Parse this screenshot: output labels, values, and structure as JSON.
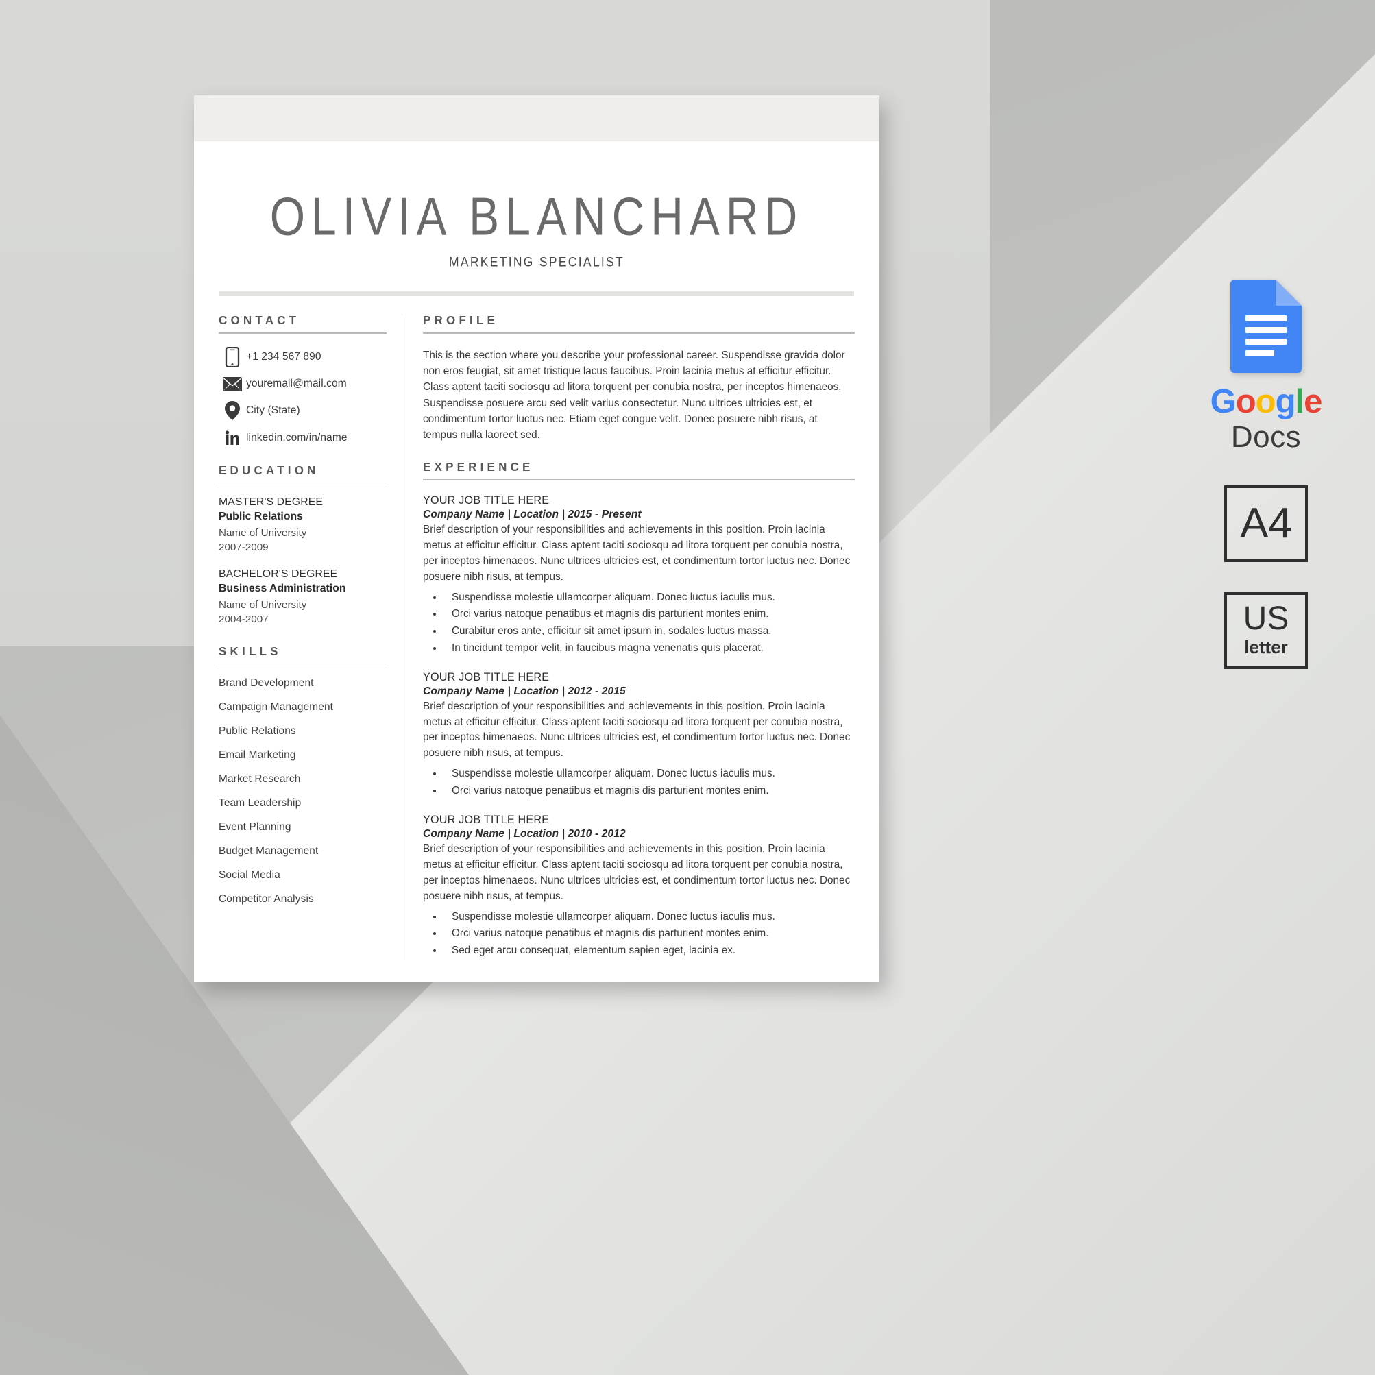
{
  "resume": {
    "name": "OLIVIA BLANCHARD",
    "job_title": "MARKETING SPECIALIST",
    "contact": {
      "heading": "CONTACT",
      "items": [
        {
          "icon": "phone-icon",
          "value": "+1 234 567 890"
        },
        {
          "icon": "envelope-icon",
          "value": "youremail@mail.com"
        },
        {
          "icon": "location-pin-icon",
          "value": "City (State)"
        },
        {
          "icon": "linkedin-icon",
          "value": "linkedin.com/in/name"
        }
      ]
    },
    "education": {
      "heading": "EDUCATION",
      "items": [
        {
          "degree": "MASTER'S DEGREE",
          "field": "Public Relations",
          "school": "Name of University",
          "years": "2007-2009"
        },
        {
          "degree": "BACHELOR'S DEGREE",
          "field": "Business Administration",
          "school": "Name of University",
          "years": "2004-2007"
        }
      ]
    },
    "skills": {
      "heading": "SKILLS",
      "items": [
        "Brand Development",
        "Campaign Management",
        "Public Relations",
        "Email Marketing",
        "Market Research",
        "Team Leadership",
        "Event Planning",
        "Budget Management",
        "Social Media",
        "Competitor Analysis"
      ]
    },
    "profile": {
      "heading": "PROFILE",
      "text": "This is the section where you describe your professional career. Suspendisse gravida dolor non eros feugiat, sit amet tristique lacus faucibus. Proin lacinia metus at efficitur efficitur. Class aptent taciti sociosqu ad litora torquent per conubia nostra, per inceptos himenaeos. Suspendisse posuere arcu sed velit varius consectetur. Nunc ultrices ultricies est, et condimentum tortor luctus nec. Etiam eget congue velit. Donec posuere nibh risus, at tempus nulla laoreet sed."
    },
    "experience": {
      "heading": "EXPERIENCE",
      "jobs": [
        {
          "title": "YOUR JOB TITLE HERE",
          "meta": "Company Name | Location | 2015 - Present",
          "description": "Brief description of your responsibilities and achievements in this position. Proin lacinia metus at efficitur efficitur. Class aptent taciti sociosqu ad litora torquent per conubia nostra, per inceptos himenaeos. Nunc ultrices ultricies est, et condimentum tortor luctus nec. Donec posuere nibh risus, at tempus.",
          "bullets": [
            "Suspendisse molestie ullamcorper aliquam. Donec luctus iaculis mus.",
            "Orci varius natoque penatibus et magnis dis parturient montes enim.",
            "Curabitur eros ante, efficitur sit amet ipsum in, sodales luctus massa.",
            "In tincidunt tempor velit, in faucibus magna venenatis quis placerat."
          ]
        },
        {
          "title": "YOUR JOB TITLE HERE",
          "meta": "Company Name | Location | 2012 - 2015",
          "description": "Brief description of your responsibilities and achievements in this position. Proin lacinia metus at efficitur efficitur. Class aptent taciti sociosqu ad litora torquent per conubia nostra, per inceptos himenaeos. Nunc ultrices ultricies est, et condimentum tortor luctus nec. Donec posuere nibh risus, at tempus.",
          "bullets": [
            "Suspendisse molestie ullamcorper aliquam. Donec luctus iaculis mus.",
            "Orci varius natoque penatibus et magnis dis parturient montes enim."
          ]
        },
        {
          "title": "YOUR JOB TITLE HERE",
          "meta": "Company Name | Location | 2010 - 2012",
          "description": "Brief description of your responsibilities and achievements in this position. Proin lacinia metus at efficitur efficitur. Class aptent taciti sociosqu ad litora torquent per conubia nostra, per inceptos himenaeos. Nunc ultrices ultricies est, et condimentum tortor luctus nec. Donec posuere nibh risus, at tempus.",
          "bullets": [
            "Suspendisse molestie ullamcorper aliquam. Donec luctus iaculis mus.",
            "Orci varius natoque penatibus et magnis dis parturient montes enim.",
            "Sed eget arcu consequat, elementum sapien eget, lacinia ex."
          ]
        }
      ]
    }
  },
  "badges": {
    "google_docs": {
      "icon": "google-docs-icon",
      "google_letters": [
        {
          "char": "G",
          "color": "#4285F4"
        },
        {
          "char": "o",
          "color": "#EA4335"
        },
        {
          "char": "o",
          "color": "#FBBC05"
        },
        {
          "char": "g",
          "color": "#4285F4"
        },
        {
          "char": "l",
          "color": "#34A853"
        },
        {
          "char": "e",
          "color": "#EA4335"
        }
      ],
      "docs_label": "Docs"
    },
    "a4": {
      "label": "A4"
    },
    "us_letter": {
      "top": "US",
      "bottom": "letter"
    }
  },
  "colors": {
    "doc_blue": "#4285F4",
    "doc_blue_light": "#82AEF8",
    "rule_gray": "#b9b9b7",
    "header_band": "#efeeec",
    "page_white": "#ffffff"
  }
}
